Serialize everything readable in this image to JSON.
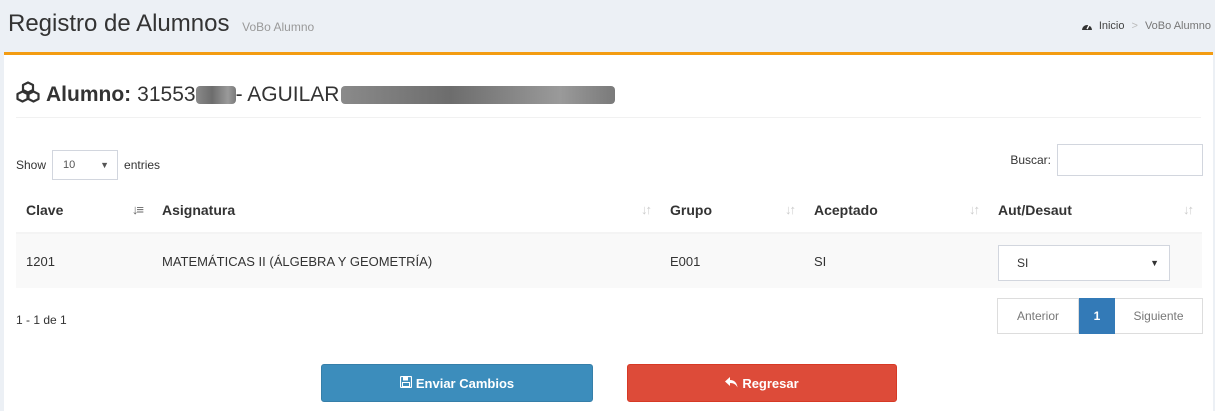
{
  "header": {
    "title": "Registro de Alumnos",
    "subtitle": "VoBo Alumno",
    "breadcrumb": {
      "home": "Inicio",
      "current": "VoBo Alumno"
    }
  },
  "student": {
    "label": "Alumno:",
    "id_prefix": "31553",
    "name_prefix": "- AGUILAR"
  },
  "table_controls": {
    "show_label": "Show",
    "entries_value": "10",
    "entries_label": "entries",
    "search_label": "Buscar:",
    "search_value": ""
  },
  "table": {
    "columns": [
      "Clave",
      "Asignatura",
      "Grupo",
      "Aceptado",
      "Aut/Desaut"
    ],
    "rows": [
      {
        "clave": "1201",
        "asignatura": "MATEMÁTICAS II (ÁLGEBRA Y GEOMETRÍA)",
        "grupo": "E001",
        "aceptado": "SI",
        "aut": "SI"
      }
    ]
  },
  "info": "1 - 1 de 1",
  "pagination": {
    "prev": "Anterior",
    "page": "1",
    "next": "Siguiente"
  },
  "buttons": {
    "save": "Enviar Cambios",
    "back": "Regresar"
  },
  "colors": {
    "accent": "#f39c12",
    "primary": "#3c8dbc",
    "danger": "#dd4b39",
    "page_active": "#337ab7"
  },
  "icons": {
    "breadcrumb": "dashboard-icon",
    "title": "cubes-icon",
    "save": "floppy-disk-icon",
    "back": "reply-arrow-icon"
  }
}
